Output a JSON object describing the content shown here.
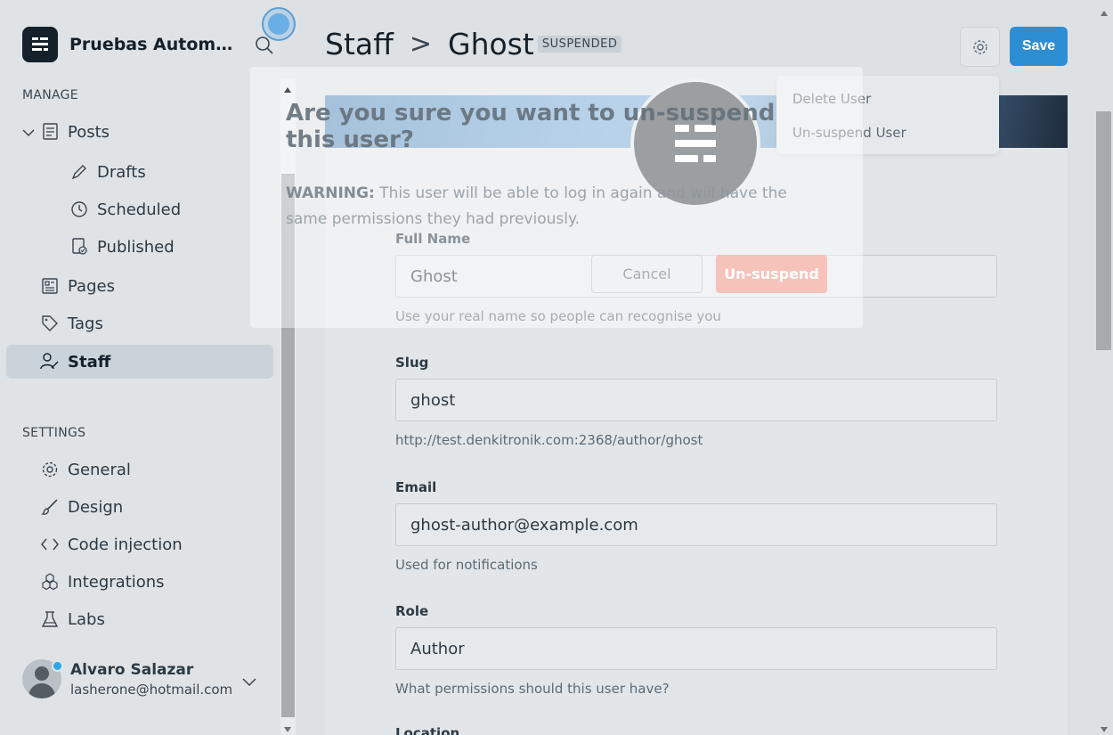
{
  "sidebar": {
    "brand_name": "Pruebas Automatiz...",
    "manage_label": "MANAGE",
    "settings_label": "SETTINGS",
    "posts": "Posts",
    "drafts": "Drafts",
    "scheduled": "Scheduled",
    "published": "Published",
    "pages": "Pages",
    "tags": "Tags",
    "staff": "Staff",
    "general": "General",
    "design": "Design",
    "code_injection": "Code injection",
    "integrations": "Integrations",
    "labs": "Labs",
    "user_name": "Alvaro Salazar",
    "user_email": "lasherone@hotmail.com"
  },
  "header": {
    "breadcrumb_parent": "Staff",
    "breadcrumb_sep": ">",
    "title": "Ghost",
    "badge": "SUSPENDED",
    "save_label": "Save"
  },
  "menu": {
    "delete_user": "Delete User",
    "unsuspend_user": "Un-suspend User"
  },
  "modal": {
    "title": "Are you sure you want to un-suspend this user?",
    "warning_label": "WARNING:",
    "warning_text": " This user will be able to log in again and will have the same permissions they had previously.",
    "cancel_label": "Cancel",
    "confirm_label": "Un-suspend"
  },
  "form": {
    "full_name_label": "Full Name",
    "full_name_value": "Ghost",
    "full_name_help": "Use your real name so people can recognise you",
    "slug_label": "Slug",
    "slug_value": "ghost",
    "slug_help": "http://test.denkitronik.com:2368/author/ghost",
    "email_label": "Email",
    "email_value": "ghost-author@example.com",
    "email_help": "Used for notifications",
    "role_label": "Role",
    "role_value": "Author",
    "role_help": "What permissions should this user have?",
    "location_label": "Location"
  },
  "colors": {
    "accent": "#2e8ed4",
    "danger": "#f6beb4",
    "sidebar_active": "#cbd3da"
  }
}
